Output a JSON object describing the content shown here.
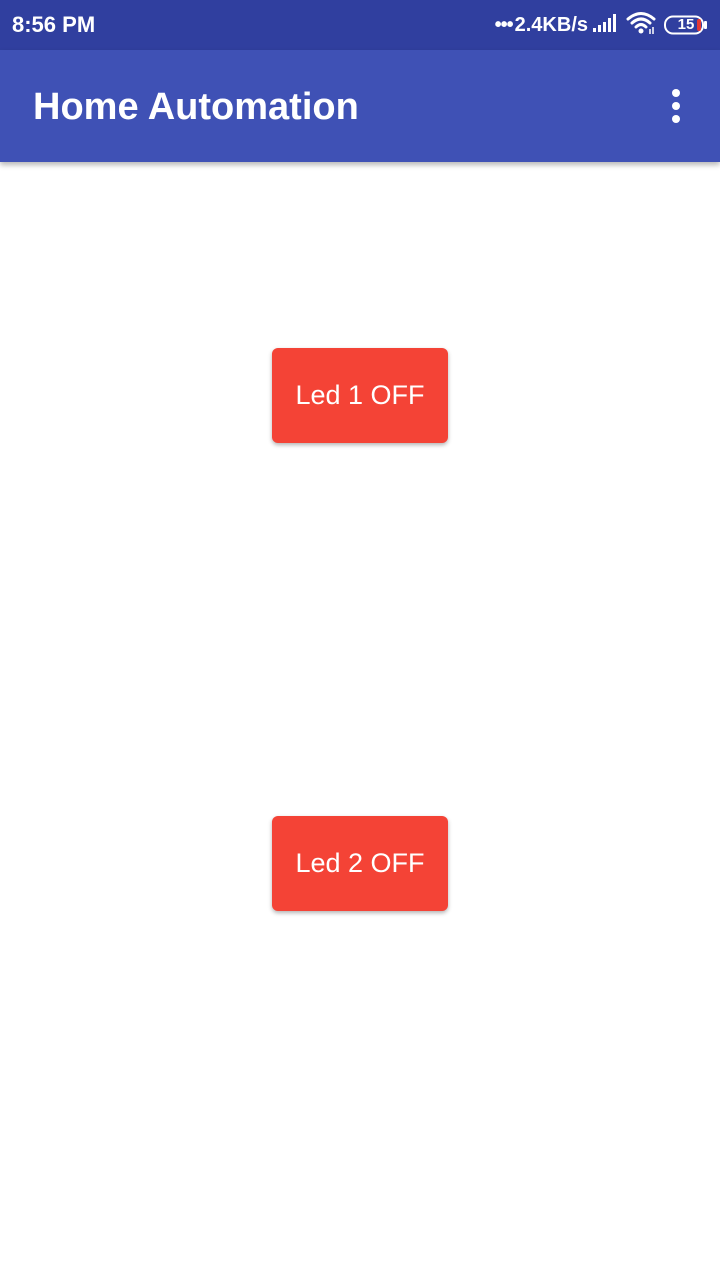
{
  "status_bar": {
    "time": "8:56 PM",
    "dots": "•••",
    "network_speed": "2.4KB/s",
    "battery": "15",
    "color": "#303f9f"
  },
  "app_bar": {
    "title": "Home Automation",
    "overflow_icon": "more-vert-icon",
    "color": "#3f51b5"
  },
  "buttons": [
    {
      "label": "Led 1 OFF",
      "color": "#f44336"
    },
    {
      "label": "Led 2 OFF",
      "color": "#f44336"
    }
  ]
}
